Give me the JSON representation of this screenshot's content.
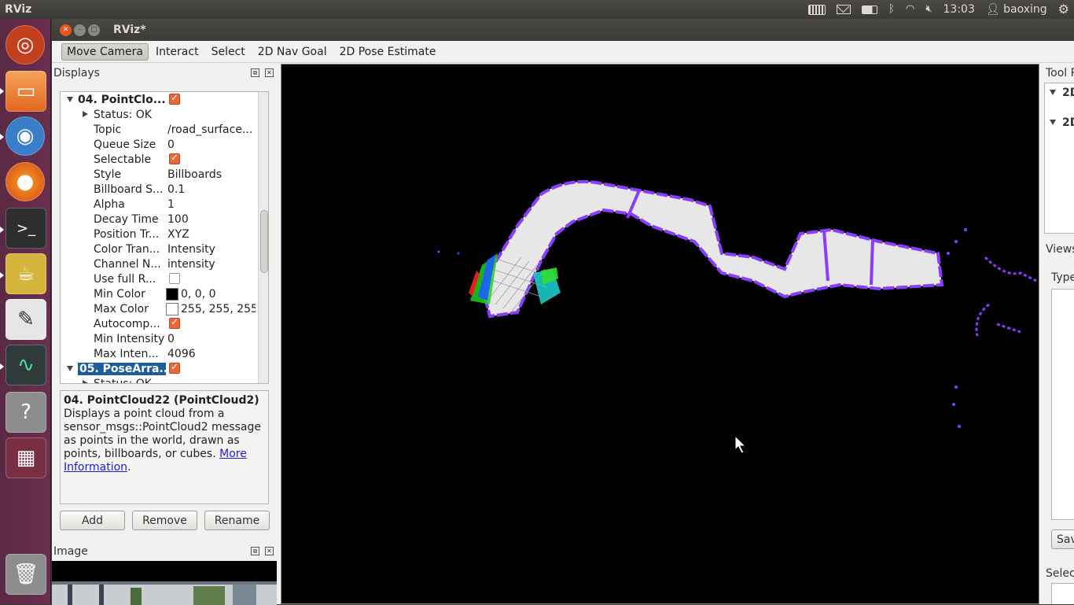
{
  "top_panel": {
    "app_name": "RViz",
    "time": "13:03",
    "user": "baoxing"
  },
  "window": {
    "title": "RViz*"
  },
  "toolbar": {
    "tools": [
      "Move Camera",
      "Interact",
      "Select",
      "2D Nav Goal",
      "2D Pose Estimate"
    ],
    "active": "Move Camera"
  },
  "displays": {
    "title": "Displays",
    "group1": {
      "name": "04. PointClo...",
      "checked": true,
      "status": "Status: OK",
      "props": [
        {
          "k": "Topic",
          "v": "/road_surface..."
        },
        {
          "k": "Queue Size",
          "v": "0"
        },
        {
          "k": "Selectable",
          "v": ""
        },
        {
          "k": "Style",
          "v": "Billboards"
        },
        {
          "k": "Billboard S...",
          "v": "0.1"
        },
        {
          "k": "Alpha",
          "v": "1"
        },
        {
          "k": "Decay Time",
          "v": "100"
        },
        {
          "k": "Position Tr...",
          "v": "XYZ"
        },
        {
          "k": "Color Tran...",
          "v": "Intensity"
        },
        {
          "k": "Channel N...",
          "v": "intensity"
        },
        {
          "k": "Use full R...",
          "v": ""
        },
        {
          "k": "Min Color",
          "v": "0, 0, 0"
        },
        {
          "k": "Max Color",
          "v": "255, 255, 255"
        },
        {
          "k": "Autocomp...",
          "v": ""
        },
        {
          "k": "Min Intensity",
          "v": "0"
        },
        {
          "k": "Max Inten...",
          "v": "4096"
        }
      ]
    },
    "group2": {
      "name": "05. PoseArra...",
      "checked": true,
      "status": "Status: OK"
    }
  },
  "description": {
    "title": "04. PointCloud22 (PointCloud2)",
    "body": "Displays a point cloud from a sensor_msgs::PointCloud2 message as points in the world, drawn as points, billboards, or cubes.",
    "link": "More Information",
    "suffix": "."
  },
  "buttons": {
    "add": "Add",
    "remove": "Remove",
    "rename": "Rename"
  },
  "image_panel": {
    "title": "Image"
  },
  "right_panel": {
    "tool_props": "Tool P",
    "item1": "2D",
    "item2": "2D",
    "views": "Views",
    "type": "Type",
    "save": "Sav",
    "selection": "Selec"
  },
  "colors": {
    "accent": "#e95420",
    "path": "#8a3cff",
    "selection": "#1e5c9a"
  }
}
